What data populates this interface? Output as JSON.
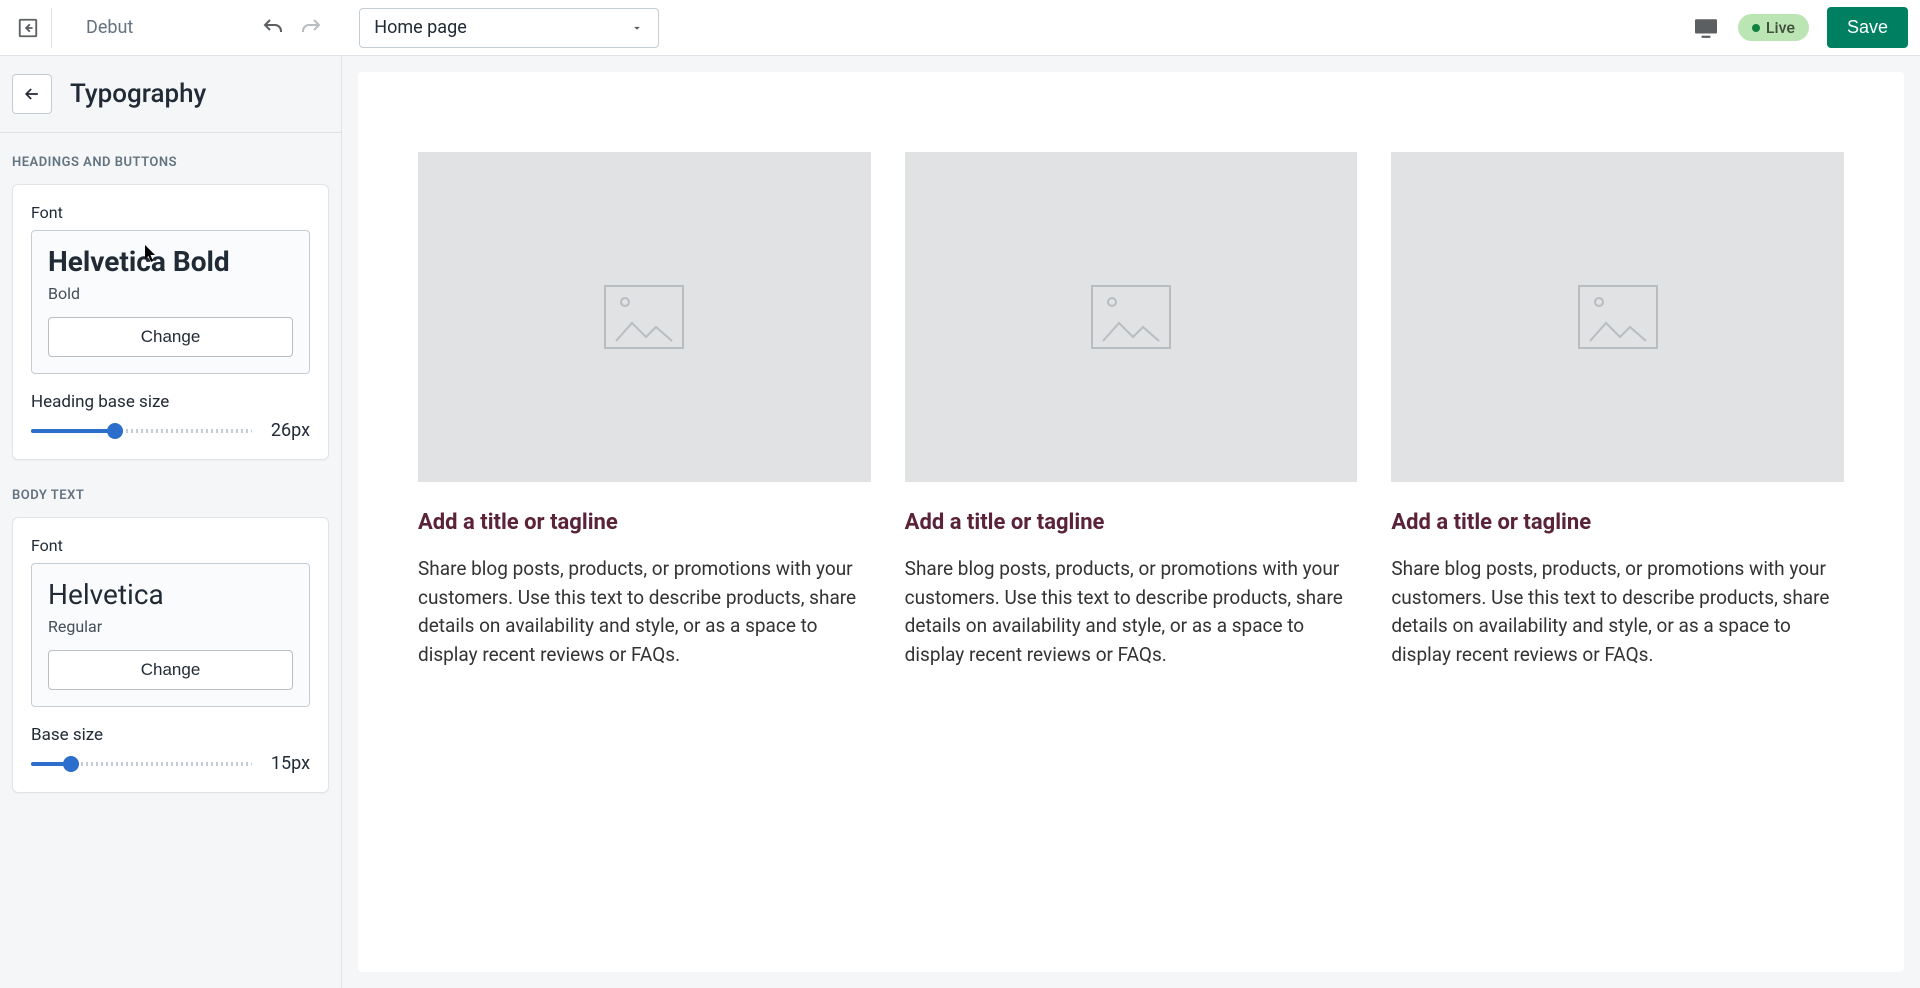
{
  "topbar": {
    "theme_name": "Debut",
    "page_selector": "Home page",
    "live_label": "Live",
    "save_label": "Save"
  },
  "panel": {
    "title": "Typography"
  },
  "headings_section": {
    "label": "HEADINGS AND BUTTONS",
    "font_label": "Font",
    "font_name": "Helvetica Bold",
    "font_style": "Bold",
    "change_label": "Change",
    "slider_label": "Heading base size",
    "slider_value": "26px",
    "slider_percent": 38
  },
  "body_section": {
    "label": "BODY TEXT",
    "font_label": "Font",
    "font_name": "Helvetica",
    "font_style": "Regular",
    "change_label": "Change",
    "slider_label": "Base size",
    "slider_value": "15px",
    "slider_percent": 18
  },
  "preview": {
    "columns": [
      {
        "title": "Add a title or tagline",
        "text": "Share blog posts, products, or promotions with your customers. Use this text to describe products, share details on availability and style, or as a space to display recent reviews or FAQs."
      },
      {
        "title": "Add a title or tagline",
        "text": "Share blog posts, products, or promotions with your customers. Use this text to describe products, share details on availability and style, or as a space to display recent reviews or FAQs."
      },
      {
        "title": "Add a title or tagline",
        "text": "Share blog posts, products, or promotions with your customers. Use this text to describe products, share details on availability and style, or as a space to display recent reviews or FAQs."
      }
    ]
  },
  "colors": {
    "accent": "#2c6ecb",
    "save": "#008060",
    "heading": "#5a2338",
    "live_bg": "#bbe5b3"
  }
}
